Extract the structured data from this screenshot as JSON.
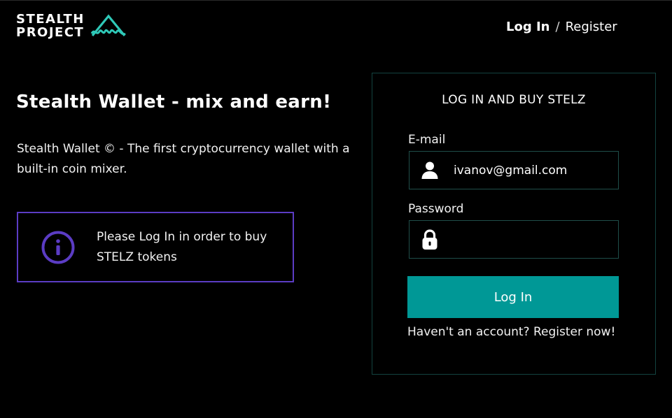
{
  "brand": {
    "line1": "STEALTH",
    "line2": "PROJECT",
    "logo_icon": "mountain-wave-icon",
    "accent_color": "#2fc9b8"
  },
  "header": {
    "login_label": "Log In",
    "separator": "/",
    "register_label": "Register"
  },
  "hero": {
    "title": "Stealth Wallet - mix and earn!",
    "description": "Stealth Wallet © - The first cryptocurrency wallet with a built-in coin mixer."
  },
  "notice": {
    "icon": "info-icon",
    "text": "Please Log In in order to buy STELZ tokens",
    "border_color": "#5b3cc4"
  },
  "login_form": {
    "title": "LOG IN AND BUY STELZ",
    "email_label": "E-mail",
    "email_value": "ivanov@gmail.com",
    "email_icon": "user-icon",
    "password_label": "Password",
    "password_value": "",
    "password_icon": "lock-icon",
    "submit_label": "Log In",
    "submit_color": "#009896",
    "register_prompt": "Haven't an account? Register now!"
  }
}
